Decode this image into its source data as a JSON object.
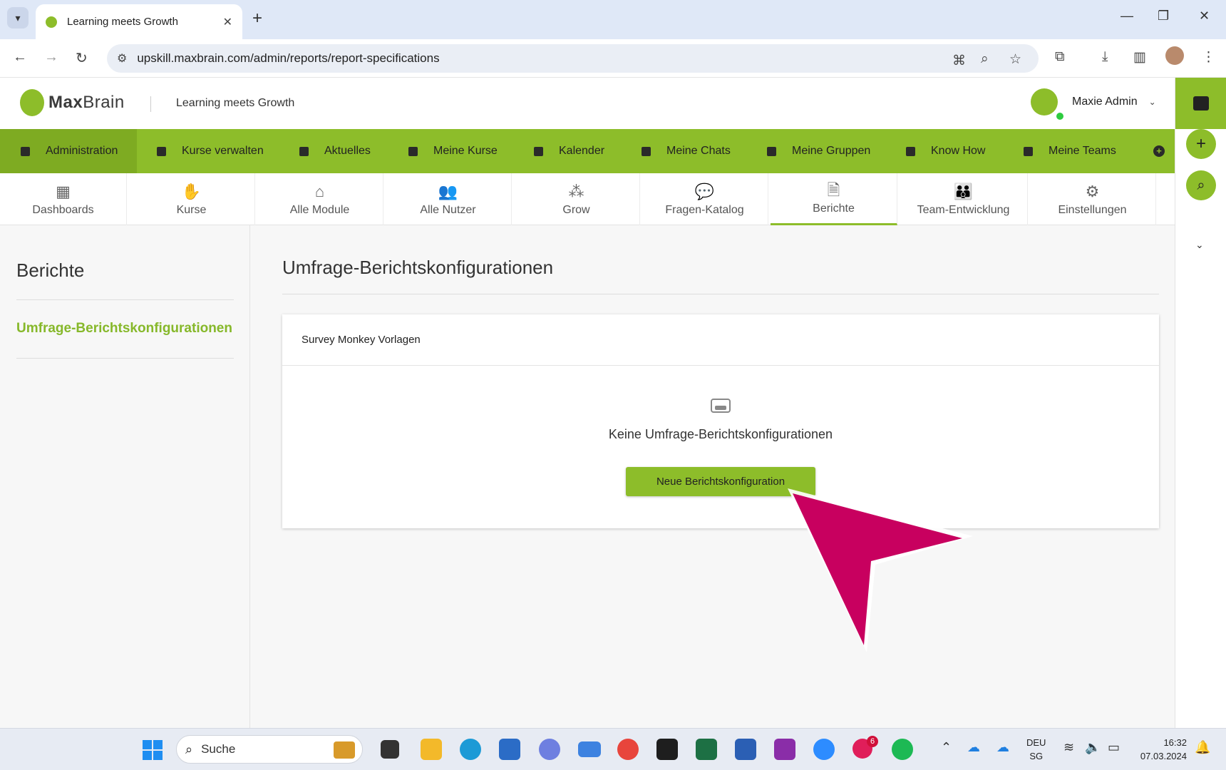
{
  "browser": {
    "tab_title": "Learning meets Growth",
    "url": "upskill.maxbrain.com/admin/reports/report-specifications"
  },
  "header": {
    "brand_bold": "Max",
    "brand_light": "Brain",
    "tagline": "Learning meets Growth",
    "user_name": "Maxie Admin"
  },
  "main_nav": {
    "items": [
      {
        "label": "Administration"
      },
      {
        "label": "Kurse verwalten"
      },
      {
        "label": "Aktuelles"
      },
      {
        "label": "Meine Kurse"
      },
      {
        "label": "Kalender"
      },
      {
        "label": "Meine Chats"
      },
      {
        "label": "Meine Gruppen"
      },
      {
        "label": "Know How"
      },
      {
        "label": "Meine Teams"
      }
    ]
  },
  "sub_nav": {
    "items": [
      {
        "label": "Dashboards"
      },
      {
        "label": "Kurse"
      },
      {
        "label": "Alle Module"
      },
      {
        "label": "Alle Nutzer"
      },
      {
        "label": "Grow"
      },
      {
        "label": "Fragen-Katalog"
      },
      {
        "label": "Berichte"
      },
      {
        "label": "Team-Entwicklung"
      },
      {
        "label": "Einstellungen"
      }
    ]
  },
  "left_panel": {
    "title": "Berichte",
    "link": "Umfrage-Berichtskonfigurationen"
  },
  "content": {
    "title": "Umfrage-Berichtskonfigurationen",
    "card_title": "Survey Monkey Vorlagen",
    "empty_text": "Keine Umfrage-Berichtskonfigurationen",
    "button_label": "Neue Berichtskonfiguration"
  },
  "taskbar": {
    "search_label": "Suche",
    "slack_badge": "6",
    "lang_line1": "DEU",
    "lang_line2": "SG",
    "time": "16:32",
    "date": "07.03.2024"
  },
  "colors": {
    "brand_green": "#8dbd2a",
    "cursor_magenta": "#c8005f"
  }
}
